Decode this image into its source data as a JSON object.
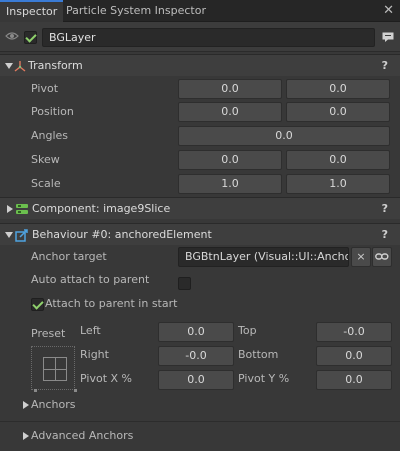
{
  "tabs": [
    {
      "label": "Inspector"
    },
    {
      "label": "Particle System Inspector"
    }
  ],
  "close_glyph": "✕",
  "object": {
    "name": "BGLayer",
    "active": true
  },
  "transform": {
    "title": "Transform",
    "help": "?",
    "rows": [
      {
        "label": "Pivot",
        "x": "0.0",
        "y": "0.0"
      },
      {
        "label": "Position",
        "x": "0.0",
        "y": "0.0"
      },
      {
        "label": "Angles",
        "value": "0.0"
      },
      {
        "label": "Skew",
        "x": "0.0",
        "y": "0.0"
      },
      {
        "label": "Scale",
        "x": "1.0",
        "y": "1.0"
      }
    ]
  },
  "component": {
    "title": "Component: image9Slice",
    "help": "?"
  },
  "behaviour": {
    "title": "Behaviour #0: anchoredElement",
    "help": "?",
    "anchor_target_label": "Anchor target",
    "anchor_target_value": "BGBtnLayer (Visual::UI::AnchorRe",
    "clear_glyph": "×",
    "auto_attach_label": "Auto attach to parent",
    "auto_attach_checked": false,
    "attach_start_label": "Attach to parent in start",
    "attach_start_checked": true,
    "preset_label": "Preset",
    "left_label": "Left",
    "left_value": "0.0",
    "top_label": "Top",
    "top_value": "-0.0",
    "right_label": "Right",
    "right_value": "-0.0",
    "bottom_label": "Bottom",
    "bottom_value": "0.0",
    "pivotx_label": "Pivot X %",
    "pivotx_value": "0.0",
    "pivoty_label": "Pivot Y %",
    "pivoty_value": "0.0",
    "anchors_label": "Anchors",
    "advanced_label": "Advanced Anchors"
  },
  "colors": {
    "background": "#383838",
    "accent": "#3a7bd5",
    "check": "#8fd16c"
  }
}
